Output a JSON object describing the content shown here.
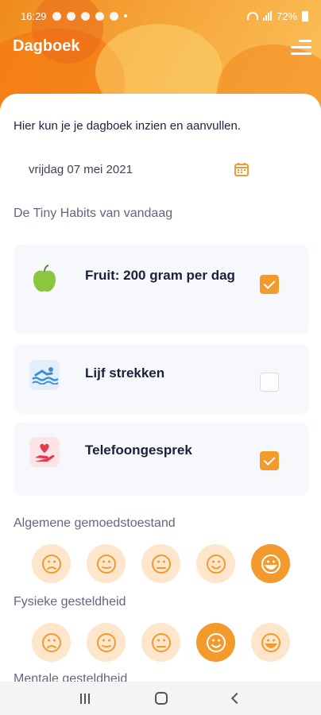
{
  "status_bar": {
    "time": "16:29",
    "battery": "72%"
  },
  "header": {
    "title": "Dagboek"
  },
  "main": {
    "intro": "Hier kun je je dagboek inzien en aanvullen.",
    "date": "vrijdag 07 mei 2021",
    "habits_title": "De Tiny Habits van vandaag",
    "habits": [
      {
        "label": "Fruit: 200 gram per dag",
        "icon": "apple-icon",
        "checked": true
      },
      {
        "label": "Lijf strekken",
        "icon": "swimmer-icon",
        "checked": false
      },
      {
        "label": "Telefoongesprek",
        "icon": "heart-hand-icon",
        "checked": true
      }
    ],
    "mood_title": "Algemene gemoedstoestand",
    "mood_selected_index": 4,
    "physical_title": "Fysieke gesteldheid",
    "physical_selected_index": 3,
    "mental_title": "Mentale gesteldheid"
  },
  "colors": {
    "accent": "#f39a2c",
    "accent_light": "#fde6cc",
    "card": "#f7f8fb"
  }
}
